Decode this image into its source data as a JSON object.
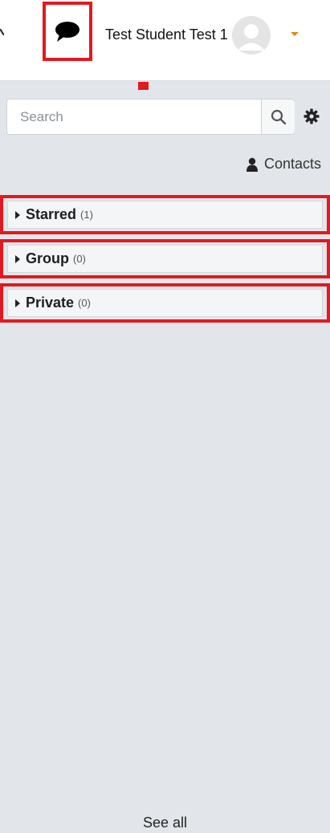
{
  "header": {
    "user_name": "Test Student Test 1",
    "accent_marker_color": "#e3191f",
    "caret_color": "#e08a12",
    "icons": [
      "message-bubble-icon",
      "avatar-placeholder-icon",
      "caret-down-icon"
    ]
  },
  "drawer": {
    "search": {
      "placeholder": "Search",
      "value": ""
    },
    "contacts_label": "Contacts",
    "sections": [
      {
        "title": "Starred",
        "count": "(1)"
      },
      {
        "title": "Group",
        "count": "(0)"
      },
      {
        "title": "Private",
        "count": "(0)"
      }
    ],
    "see_all_label": "See all"
  }
}
